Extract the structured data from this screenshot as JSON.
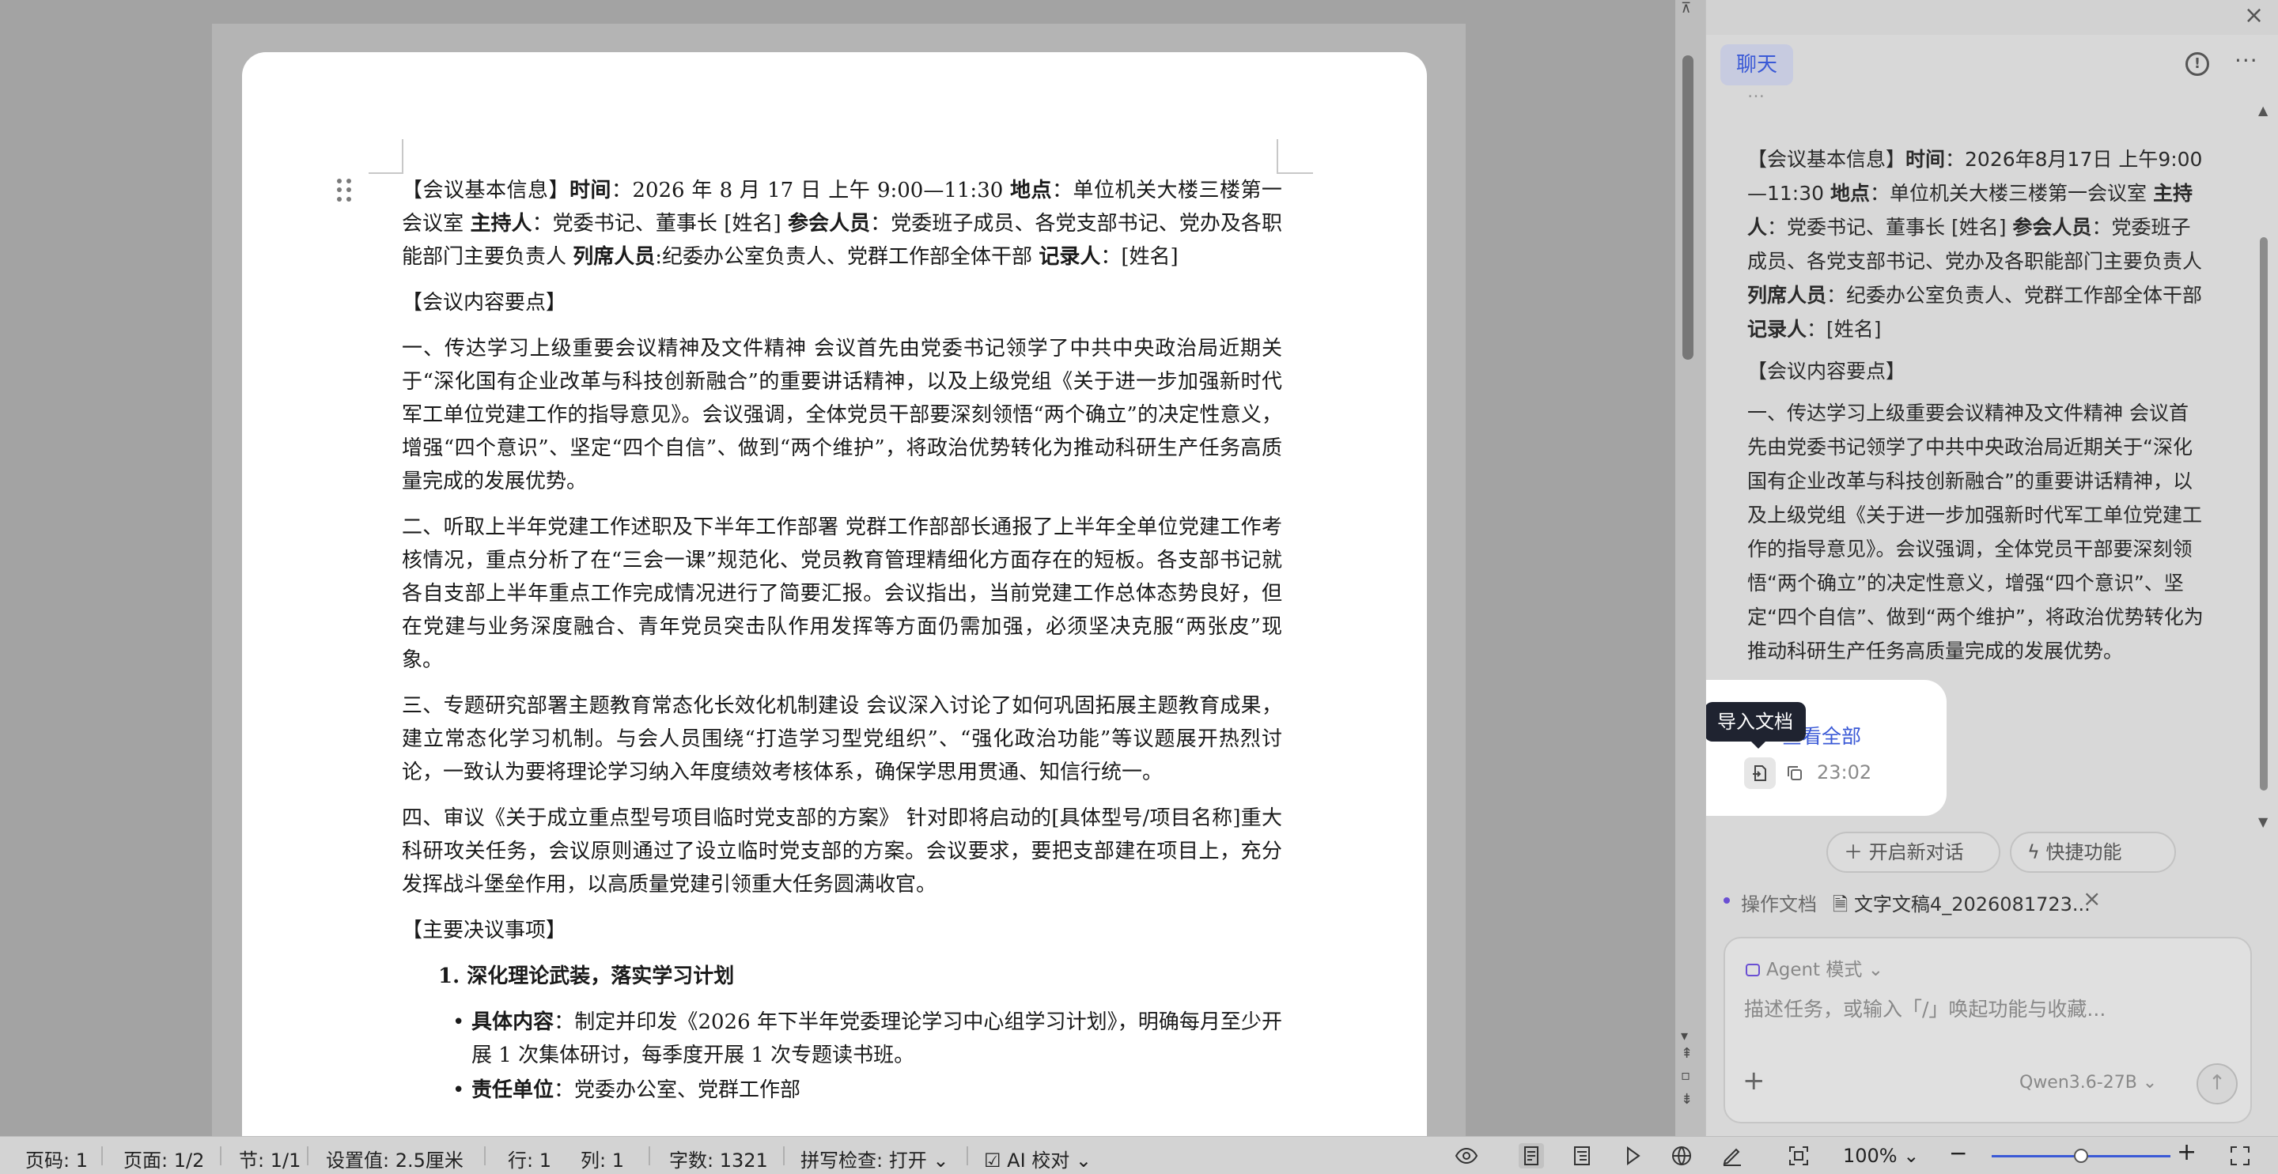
{
  "document": {
    "meeting_info": {
      "heading": "【会议基本信息】",
      "time_label": "时间",
      "time_value": "：2026 年 8 月 17 日 上午 9:00—11:30 ",
      "place_label": "地点",
      "place_value": "：单位机关大楼三楼第一会议室 ",
      "host_label": "主持人",
      "host_value": "：党委书记、董事长 [姓名] ",
      "attendees_label": "参会人员",
      "attendees_value": "：党委班子成员、各党支部书记、党办及各职能部门主要负责人 ",
      "observers_label": "列席人员",
      "observers_value": ":纪委办公室负责人、党群工作部全体干部 ",
      "recorder_label": "记录人",
      "recorder_value": "：[姓名]"
    },
    "content_heading": "【会议内容要点】",
    "item1": "一、传达学习上级重要会议精神及文件精神 会议首先由党委书记领学了中共中央政治局近期关于“深化国有企业改革与科技创新融合”的重要讲话精神，以及上级党组《关于进一步加强新时代军工单位党建工作的指导意见》。会议强调，全体党员干部要深刻领悟“两个确立”的决定性意义，增强“四个意识”、坚定“四个自信”、做到“两个维护”，将政治优势转化为推动科研生产任务高质量完成的发展优势。",
    "item2": "二、听取上半年党建工作述职及下半年工作部署 党群工作部部长通报了上半年全单位党建工作考核情况，重点分析了在“三会一课”规范化、党员教育管理精细化方面存在的短板。各支部书记就各自支部上半年重点工作完成情况进行了简要汇报。会议指出，当前党建工作总体态势良好，但在党建与业务深度融合、青年党员突击队作用发挥等方面仍需加强，必须坚决克服“两张皮”现象。",
    "item3": "三、专题研究部署主题教育常态化长效化机制建设 会议深入讨论了如何巩固拓展主题教育成果，建立常态化学习机制。与会人员围绕“打造学习型党组织”、“强化政治功能”等议题展开热烈讨论，一致认为要将理论学习纳入年度绩效考核体系，确保学思用贯通、知信行统一。",
    "item4": "四、审议《关于成立重点型号项目临时党支部的方案》 针对即将启动的[具体型号/项目名称]重大科研攻关任务，会议原则通过了设立临时党支部的方案。会议要求，要把支部建在项目上，充分发挥战斗堡垒作用，以高质量党建引领重大任务圆满收官。",
    "decisions_heading": "【主要决议事项】",
    "decision1_title": "1. 深化理论武装，落实学习计划",
    "bullet1_label": "具体内容",
    "bullet1_value": "：制定并印发《2026 年下半年党委理论学习中心组学习计划》，明确每月至少开展 1 次集体研讨，每季度开展 1 次专题读书班。",
    "bullet2_label": "责任单位",
    "bullet2_value": "：党委办公室、党群工作部"
  },
  "panel": {
    "chat_tab": "聊天",
    "top_fade": "…",
    "message": {
      "heading": "【会议基本信息】",
      "time_label": "时间",
      "time_value": "：2026年8月17日 上午9:00—11:30 ",
      "place_label": "地点",
      "place_value": "：单位机关大楼三楼第一会议室 ",
      "host_label": "主持人",
      "host_value": "：党委书记、董事长 [姓名] ",
      "attendees_label": "参会人员",
      "attendees_value": "：党委班子成员、各党支部书记、党办及各职能部门主要负责人 ",
      "observers_label": "列席人员",
      "observers_value": "：纪委办公室负责人、党群工作部全体干部 ",
      "recorder_label": "记录人",
      "recorder_value": "：[姓名]",
      "content_heading": "【会议内容要点】",
      "item1": "一、传达学习上级重要会议精神及文件精神 会议首先由党委书记领学了中共中央政治局近期关于“深化国有企业改革与科技创新融合”的重要讲话精神，以及上级党组《关于进一步加强新时代军工单位党建工作的指导意见》。会议强调，全体党员干部要深刻领悟“两个确立”的决定性意义，增强“四个意识”、坚定“四个自信”、做到“两个维护”，将政治优势转化为推动科研生产任务高质量完成的发展优势。"
    },
    "view_all": "查看全部",
    "tooltip": "导入文档",
    "time": "23:02",
    "new_chat": "开启新对话",
    "quick_func": "快捷功能",
    "op_label": "操作文档",
    "op_file": "文字文稿4_2026081723...",
    "agent_mode": "Agent 模式",
    "input_placeholder": "描述任务，或输入「/」唤起功能与收藏...",
    "model": "Qwen3.6-27B"
  },
  "status": {
    "page_code": "页码: 1",
    "pages": "页面: 1/2",
    "section": "节: 1/1",
    "setting": "设置值: 2.5厘米",
    "row": "行: 1",
    "col": "列: 1",
    "word_count": "字数: 1321",
    "spell_check": "拼写检查: 打开",
    "ai_check": "AI 校对",
    "zoom": "100%",
    "zoom_level": 0.5
  },
  "colors": {
    "accent": "#3a59d6",
    "agent": "#6a4fd3",
    "tooltip_bg": "#1f2330"
  }
}
